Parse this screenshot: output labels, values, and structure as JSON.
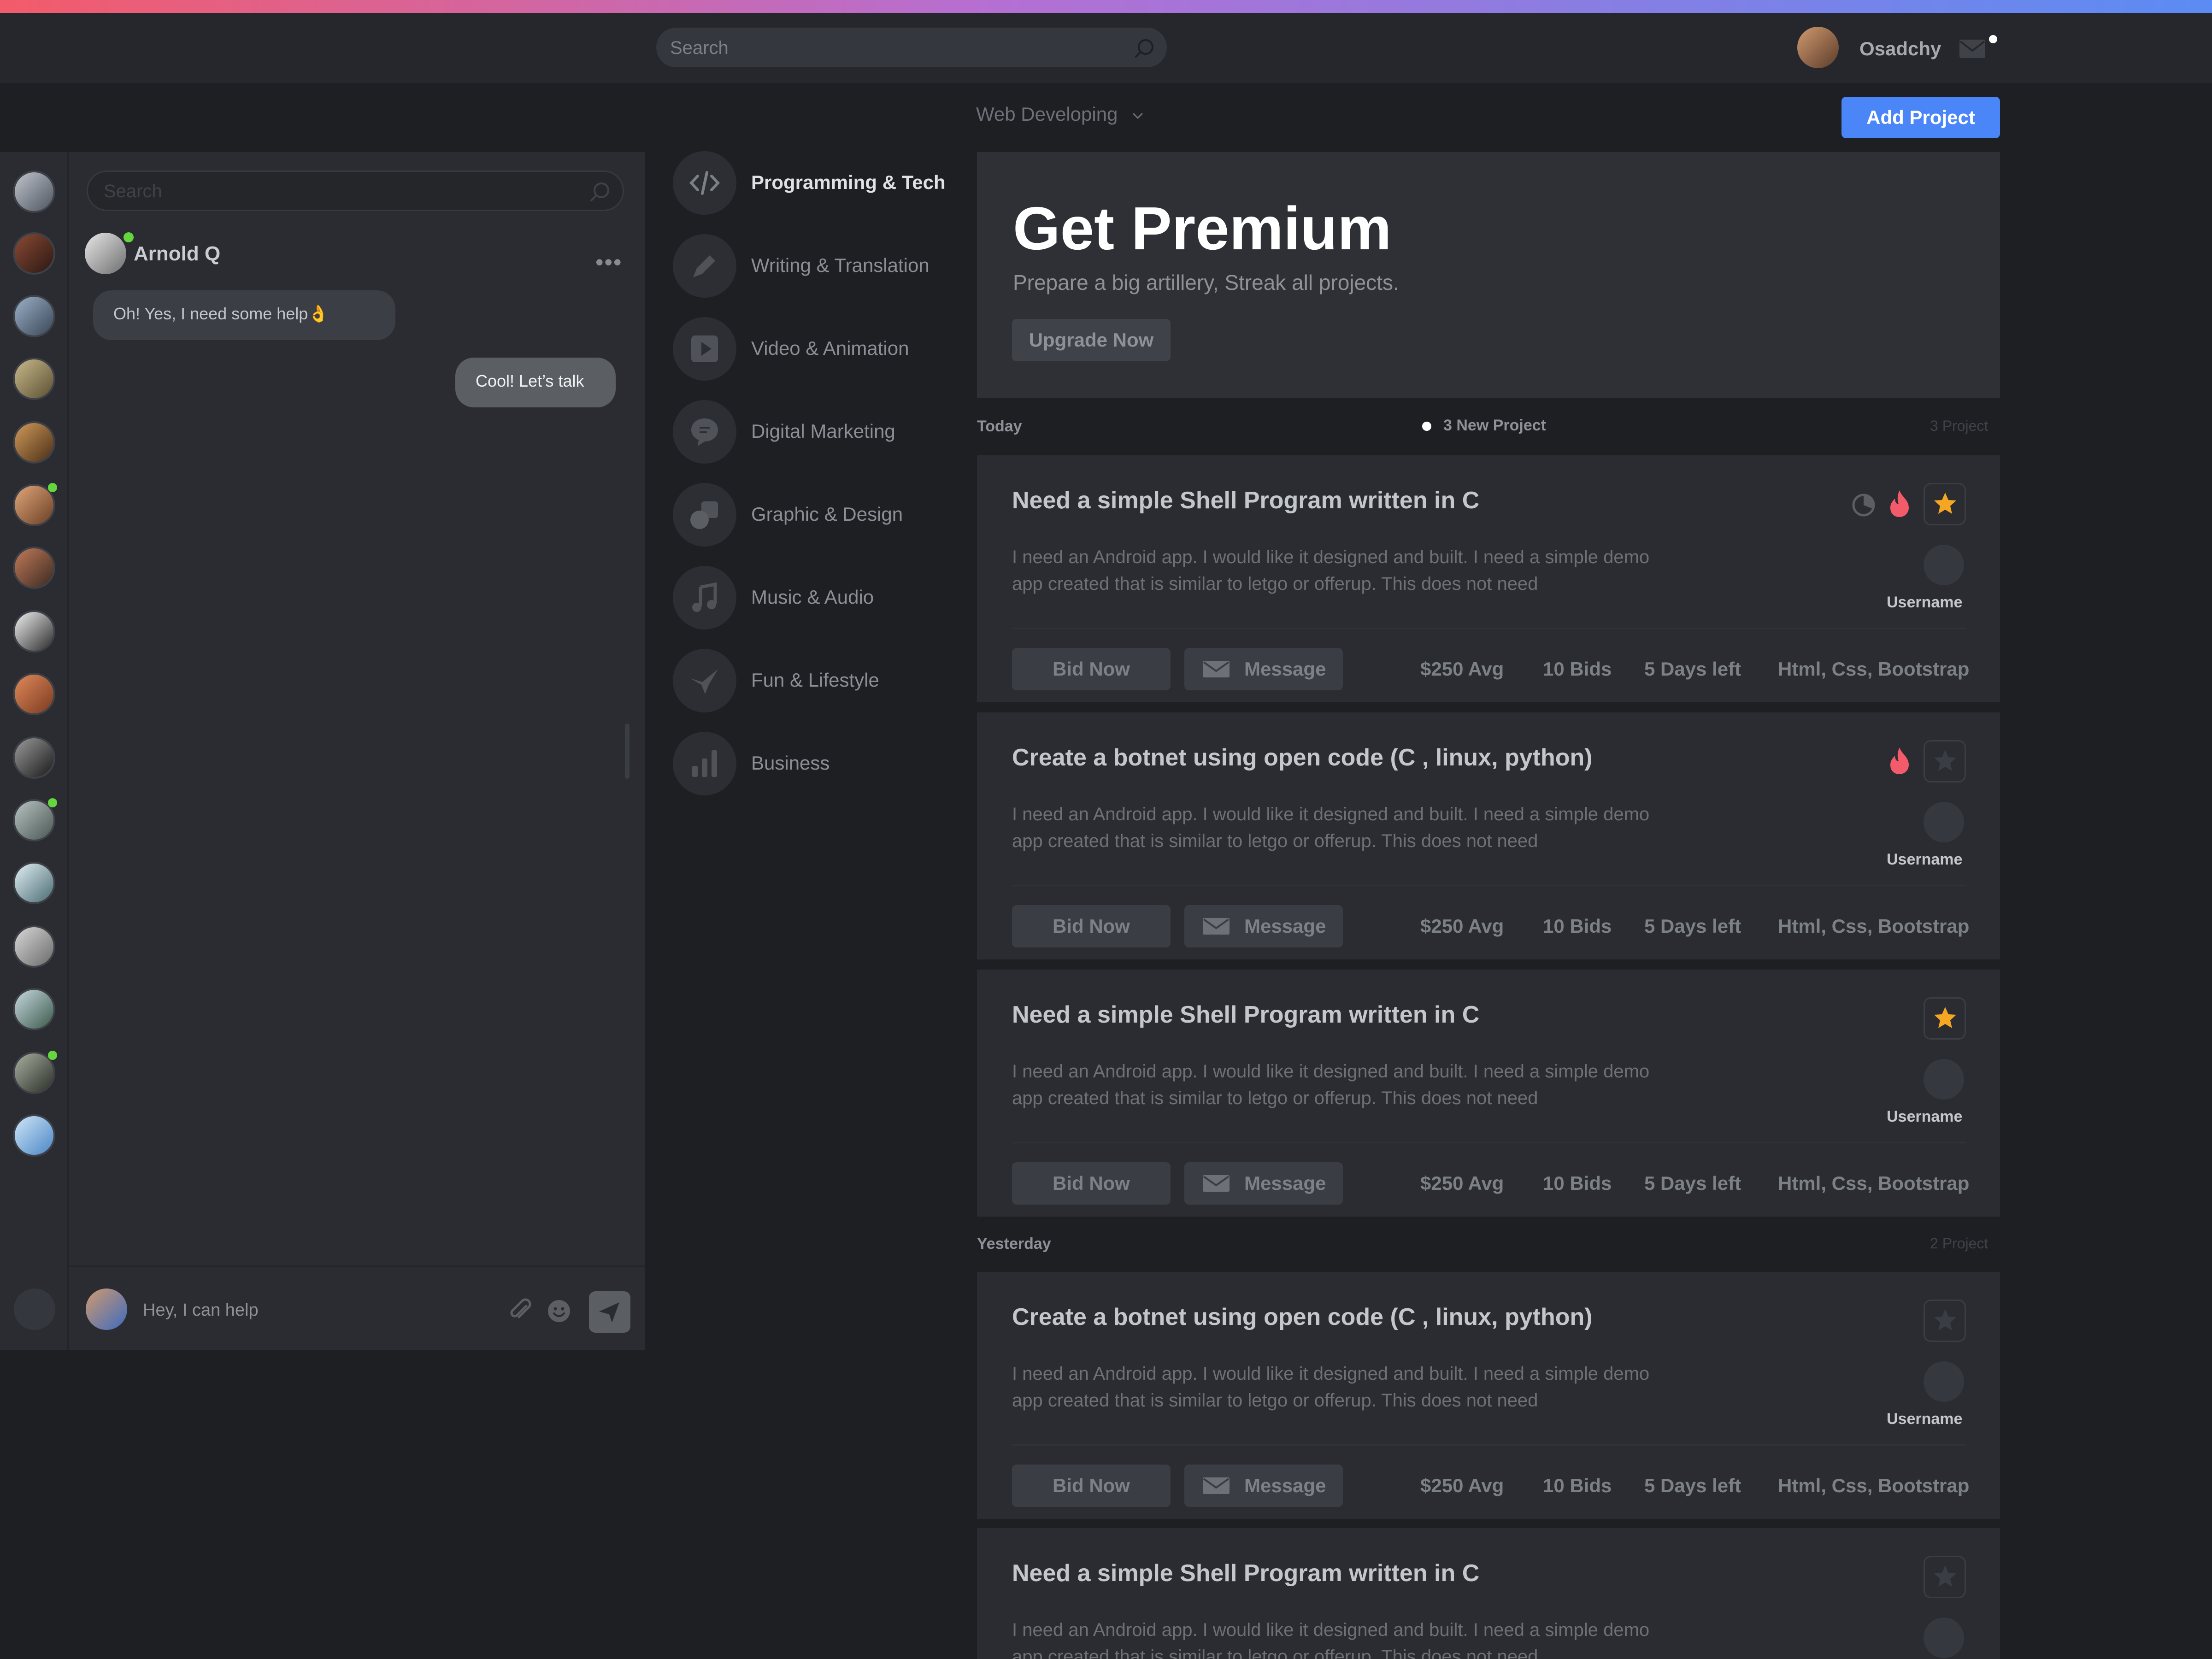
{
  "colors": {
    "accent": "#4a86f7",
    "online": "#64d63e",
    "fire": "#f35b6a",
    "star": "#f5a623"
  },
  "header": {
    "search_placeholder": "Search",
    "user_name": "Osadchy"
  },
  "subbar": {
    "category_dropdown": "Web Developing",
    "add_project_label": "Add Project"
  },
  "chat": {
    "search_placeholder": "Search",
    "contact_name": "Arnold Q",
    "messages": [
      {
        "direction": "in",
        "text": "Oh! Yes, I need some help👌"
      },
      {
        "direction": "out",
        "text": "Cool! Let’s talk"
      }
    ],
    "input_placeholder": "Hey, I can help",
    "contacts_count_visible": 16
  },
  "categories": [
    {
      "label": "Programming & Tech",
      "icon": "code-icon",
      "active": true
    },
    {
      "label": "Writing & Translation",
      "icon": "pen-icon",
      "active": false
    },
    {
      "label": "Video & Animation",
      "icon": "play-icon",
      "active": false
    },
    {
      "label": "Digital Marketing",
      "icon": "chat-icon",
      "active": false
    },
    {
      "label": "Graphic & Design",
      "icon": "shapes-icon",
      "active": false
    },
    {
      "label": "Music & Audio",
      "icon": "music-icon",
      "active": false
    },
    {
      "label": "Fun & Lifestyle",
      "icon": "bird-icon",
      "active": false
    },
    {
      "label": "Business",
      "icon": "bar-chart-icon",
      "active": false
    }
  ],
  "premium": {
    "title": "Get Premium",
    "subtitle": "Prepare a big artillery, Streak all projects.",
    "button": "Upgrade Now"
  },
  "sections": {
    "today": {
      "label": "Today",
      "count": "3 Project",
      "new_projects": "3 New Project"
    },
    "yesterday": {
      "label": "Yesterday",
      "count": "2 Project"
    }
  },
  "project_common": {
    "description": "I need an Android app. I would like it designed and built. I need a simple demo app created that is similar to letgo or offerup. This does not need",
    "username": "Username",
    "bid_label": "Bid Now",
    "message_label": "Message",
    "avg": "$250 Avg",
    "bids": "10 Bids",
    "days_left": "5 Days left",
    "tags": "Html, Css, Bootstrap"
  },
  "projects": [
    {
      "title": "Need a simple Shell Program written in C",
      "starred": true,
      "hot": true,
      "timer": true
    },
    {
      "title": "Create a botnet using open code (C , linux, python)",
      "starred": false,
      "hot": true,
      "timer": false
    },
    {
      "title": "Need a simple Shell Program written in C",
      "starred": true,
      "hot": false,
      "timer": false
    },
    {
      "title": "Create a botnet using open code (C , linux, python)",
      "starred": false,
      "hot": false,
      "timer": false
    },
    {
      "title": "Need a simple Shell Program written in C",
      "starred": false,
      "hot": false,
      "timer": false
    }
  ]
}
